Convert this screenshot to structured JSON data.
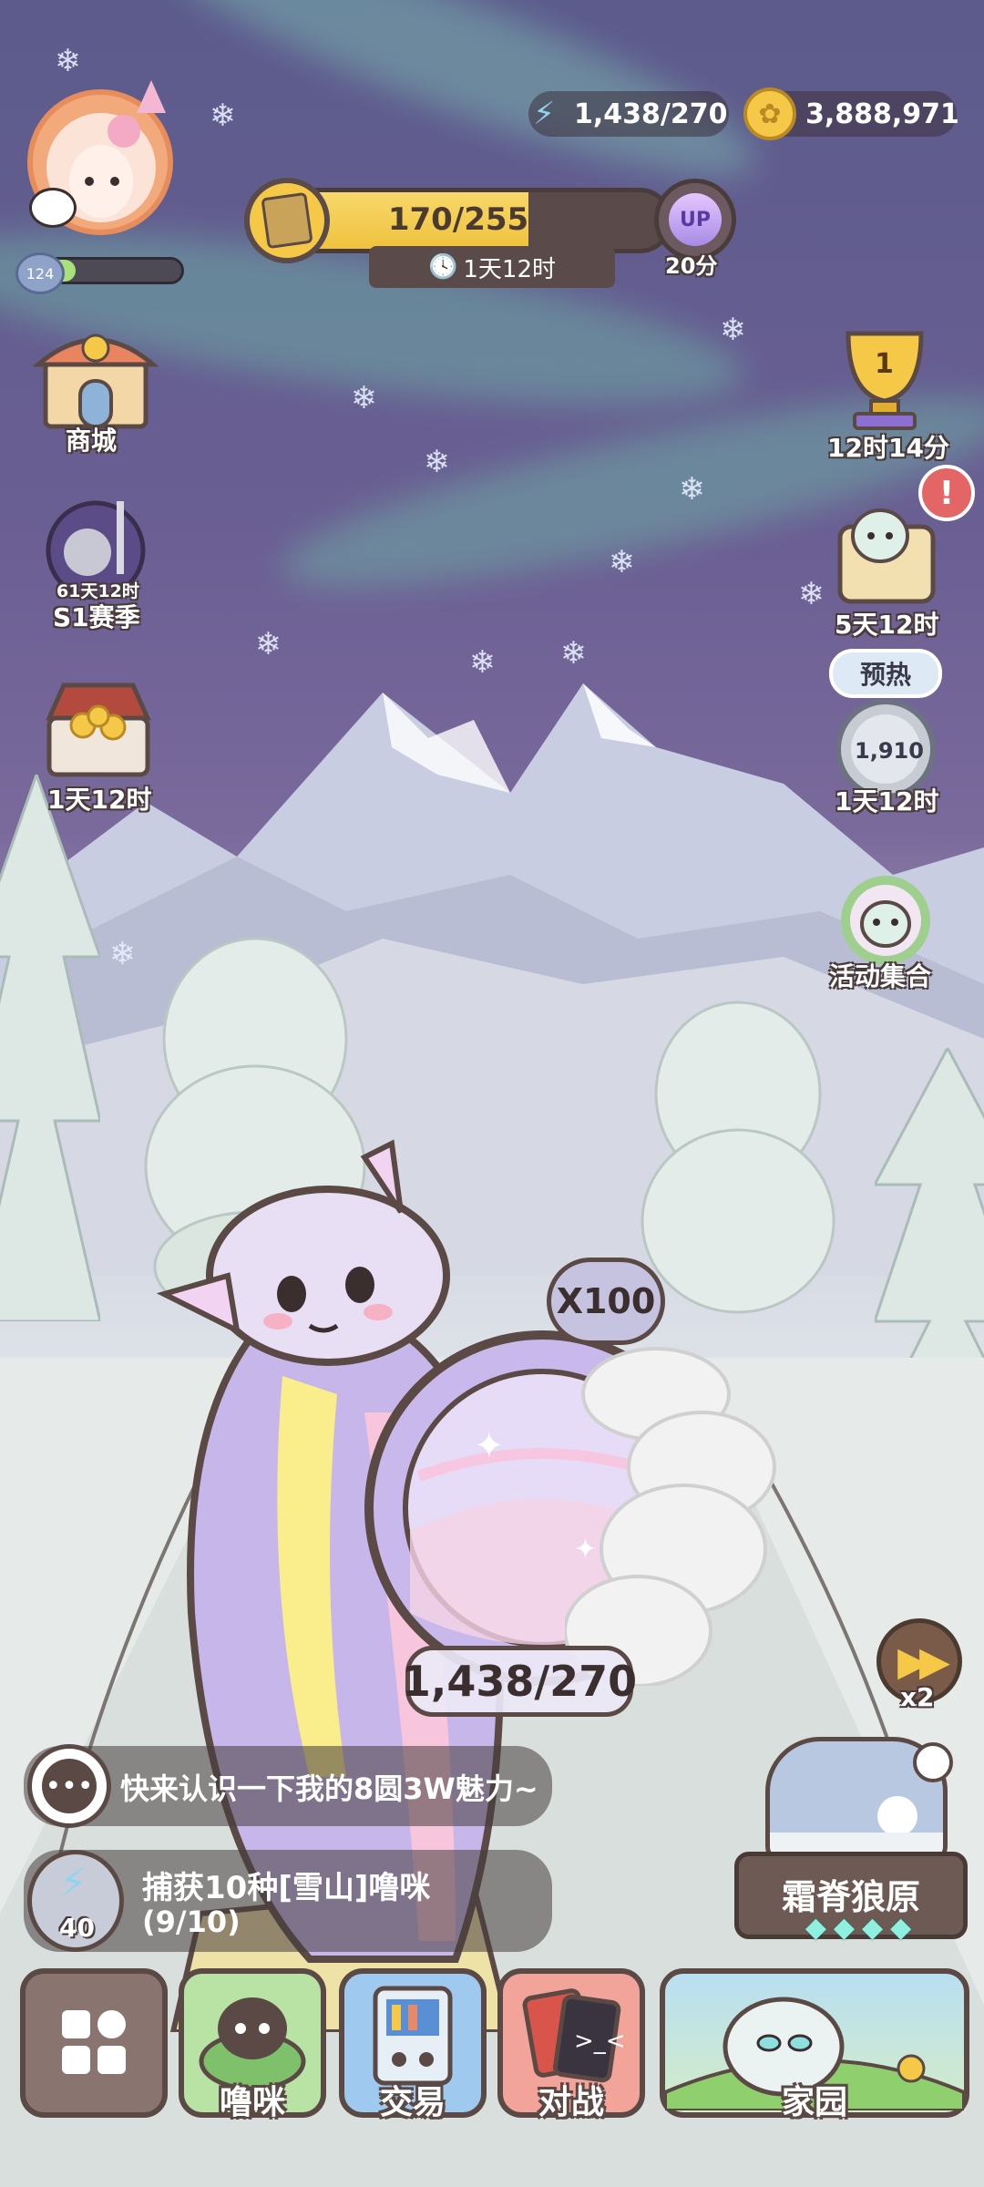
{
  "colors": {
    "sky": "#5c5b8c",
    "snow": "#e6eae8",
    "ui_dark": "#5a4945",
    "gold": "#f6c847",
    "energy": "#8fd4f0"
  },
  "resources": {
    "energy": "1,438/270",
    "coins": "3,888,971",
    "energy_icon": "lightning-icon",
    "coin_icon": "coin-icon"
  },
  "player": {
    "level": "124",
    "level_progress": 0.34
  },
  "progress": {
    "value": "170/255",
    "fraction": 0.667,
    "timer": "1天12时",
    "up_label": "UP",
    "up_sub": "20分"
  },
  "left_menu": [
    {
      "label": "商城",
      "icon": "shop-icon"
    },
    {
      "label": "S1赛季",
      "sub": "61天12时",
      "icon": "knight-icon"
    },
    {
      "label": "1天12时",
      "icon": "treasure-chest-icon"
    }
  ],
  "right_menu": [
    {
      "label": "12时14分",
      "badge": "1",
      "icon": "trophy-icon"
    },
    {
      "label": "5天12时",
      "icon": "map-scroll-icon"
    },
    {
      "header": "预热",
      "value": "1,910",
      "label": "1天12时",
      "icon": "medal-icon"
    },
    {
      "label": "活动集合",
      "icon": "event-wreath-icon"
    }
  ],
  "capture": {
    "multiplier": "X100",
    "energy": "1,438/270"
  },
  "speed": {
    "label": "x2",
    "icon": "fast-forward-icon"
  },
  "chat": {
    "text": "快来认识一下我的8圆3W魅力~",
    "icon": "chat-bubble-icon"
  },
  "quest": {
    "text": "捕获10种[雪山]噜咪",
    "progress": "(9/10)",
    "reward": "40",
    "icon": "lightning-icon"
  },
  "area": {
    "name": "霜脊狼原",
    "stars": 4,
    "star_glyph": "◆"
  },
  "nav": [
    {
      "label": "",
      "icon": "menu-grid-icon"
    },
    {
      "label": "噜咪",
      "icon": "pet-bowl-icon"
    },
    {
      "label": "交易",
      "icon": "trade-machine-icon"
    },
    {
      "label": "对战",
      "icon": "battle-cards-icon"
    },
    {
      "label": "家园",
      "icon": "home-garden-icon"
    }
  ]
}
